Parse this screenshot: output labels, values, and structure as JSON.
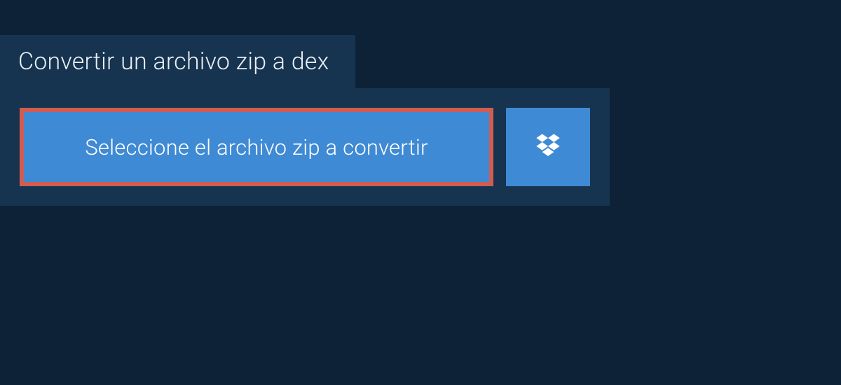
{
  "header": {
    "title": "Convertir un archivo zip a dex"
  },
  "actions": {
    "select_file_label": "Seleccione el archivo zip a convertir",
    "dropbox_icon": "dropbox-icon"
  },
  "colors": {
    "background": "#0d2236",
    "panel": "#16334f",
    "button": "#3f8ad4",
    "highlight_border": "#d15c52",
    "text": "#ffffff"
  }
}
